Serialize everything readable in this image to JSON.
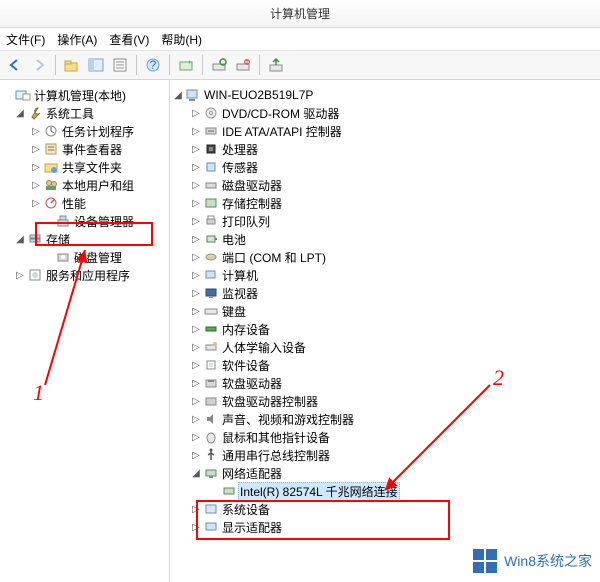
{
  "title": "计算机管理",
  "menu": {
    "file": "文件(F)",
    "action": "操作(A)",
    "view": "查看(V)",
    "help": "帮助(H)"
  },
  "left_tree": {
    "root": "计算机管理(本地)",
    "system_tools": "系统工具",
    "task_scheduler": "任务计划程序",
    "event_viewer": "事件查看器",
    "shared_folders": "共享文件夹",
    "local_users": "本地用户和组",
    "performance": "性能",
    "device_manager": "设备管理器",
    "storage": "存储",
    "disk_mgmt": "磁盘管理",
    "services_apps": "服务和应用程序"
  },
  "right_tree": {
    "host": "WIN-EUO2B519L7P",
    "dvd": "DVD/CD-ROM 驱动器",
    "ide": "IDE ATA/ATAPI 控制器",
    "cpu": "处理器",
    "sensor": "传感器",
    "disk": "磁盘驱动器",
    "storage_ctrl": "存储控制器",
    "print_queue": "打印队列",
    "battery": "电池",
    "ports": "端口 (COM 和 LPT)",
    "computer": "计算机",
    "monitor": "监视器",
    "keyboard": "键盘",
    "memory": "内存设备",
    "hid": "人体学输入设备",
    "software": "软件设备",
    "floppy": "软盘驱动器",
    "floppy_ctrl": "软盘驱动器控制器",
    "sound": "声音、视频和游戏控制器",
    "mouse": "鼠标和其他指针设备",
    "usb": "通用串行总线控制器",
    "network_adapter": "网络适配器",
    "nic_intel": "Intel(R) 82574L 千兆网络连接",
    "system_dev": "系统设备",
    "display_adapter": "显示适配器"
  },
  "annotations": {
    "one": "1",
    "two": "2"
  },
  "watermark": "Win8系统之家"
}
